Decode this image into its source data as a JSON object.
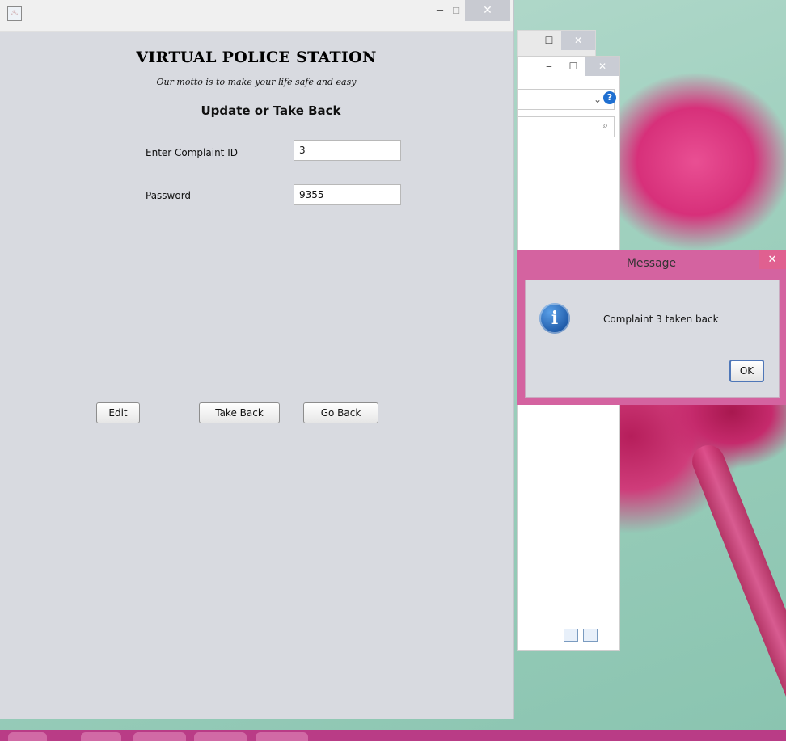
{
  "window": {
    "app_icon": "java-icon",
    "minimize_glyph": "‒",
    "maximize_glyph": "☐",
    "close_glyph": "✕"
  },
  "app": {
    "title": "VIRTUAL POLICE STATION",
    "motto": "Our motto is to make your life safe and easy",
    "subtitle": "Update or Take Back"
  },
  "form": {
    "complaint_id_label": "Enter Complaint ID",
    "complaint_id_value": "3",
    "password_label": "Password",
    "password_value": "9355"
  },
  "buttons": {
    "edit": "Edit",
    "take_back": "Take Back",
    "go_back": "Go Back"
  },
  "dialog": {
    "title": "Message",
    "close_glyph": "✕",
    "message": "Complaint 3 taken back",
    "ok": "OK",
    "icon": "info-icon"
  },
  "background_window": {
    "minimize_glyph": "‒",
    "maximize_glyph": "☐",
    "close_glyph": "✕",
    "chevron": "⌄",
    "help": "?",
    "search_glyph": "⌕"
  },
  "colors": {
    "accent_dialog": "#d463a0",
    "taskbar": "#b93c86",
    "window_bg": "#d8dae0"
  }
}
